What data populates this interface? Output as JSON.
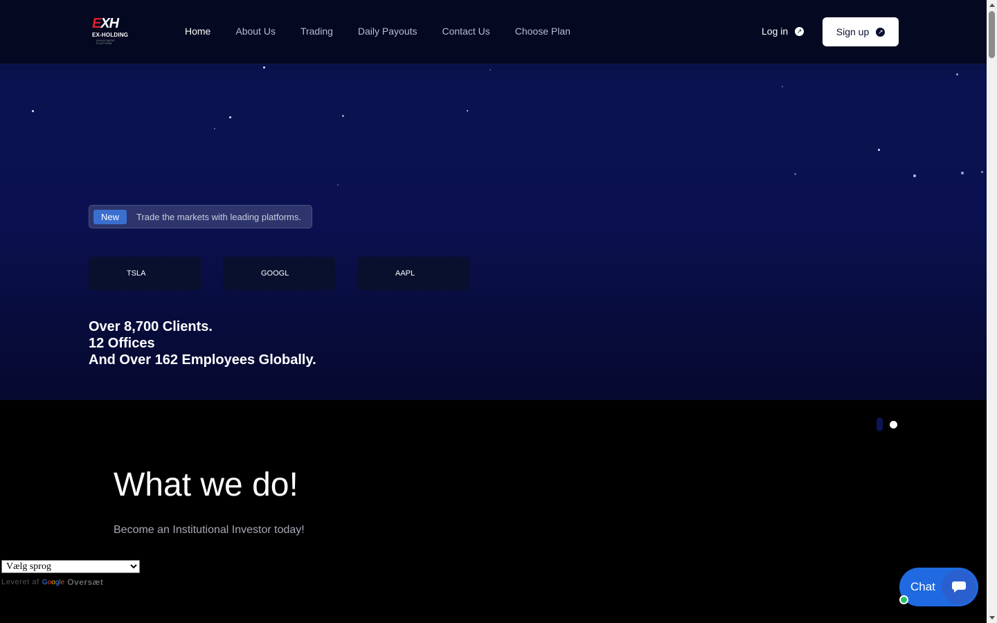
{
  "header": {
    "logo": {
      "mark_e": "E",
      "mark_rest": "XH",
      "brand": "EX-HOLDING",
      "tagline": "INVESTMENT PLATFORM"
    },
    "nav": [
      {
        "label": "Home",
        "active": true
      },
      {
        "label": "About Us"
      },
      {
        "label": "Trading"
      },
      {
        "label": "Daily Payouts"
      },
      {
        "label": "Contact Us"
      },
      {
        "label": "Choose Plan"
      }
    ],
    "login_label": "Log in",
    "signup_label": "Sign up"
  },
  "hero": {
    "badge": "New",
    "announcement": "Trade the markets with leading platforms.",
    "tickers": [
      "TSLA",
      "GOOGL",
      "AAPL"
    ],
    "stats": [
      "Over 8,700 Clients.",
      "12 Offices",
      "And Over 162 Employees Globally."
    ]
  },
  "section": {
    "title": "What we do!",
    "subtitle": "Become an Institutional Investor today!"
  },
  "translate": {
    "select_value": "Vælg sprog",
    "powered_by": "Leveret af",
    "google": "Google",
    "translate_label": "Oversæt"
  },
  "chat": {
    "label": "Chat"
  },
  "colors": {
    "accent": "#1f6ae0",
    "badge": "#3a6fd0",
    "hero_bg": "#0b1150",
    "online": "#27c25e"
  }
}
